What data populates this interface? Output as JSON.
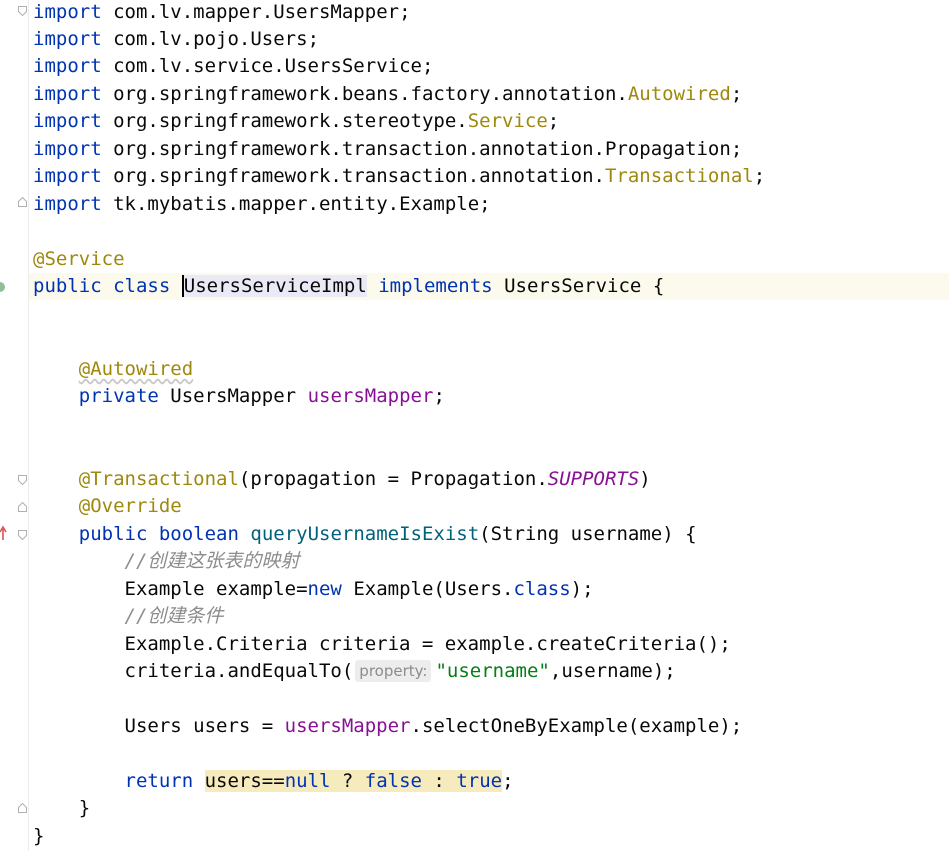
{
  "editor": {
    "imports": [
      {
        "kw": "import",
        "path": "com.lv.mapper.UsersMapper",
        "ann": "",
        "end": ";"
      },
      {
        "kw": "import",
        "path": "com.lv.pojo.Users",
        "ann": "",
        "end": ";"
      },
      {
        "kw": "import",
        "path": "com.lv.service.UsersService",
        "ann": "",
        "end": ";"
      },
      {
        "kw": "import",
        "path": "org.springframework.beans.factory.annotation.",
        "ann": "Autowired",
        "end": ";"
      },
      {
        "kw": "import",
        "path": "org.springframework.stereotype.",
        "ann": "Service",
        "end": ";"
      },
      {
        "kw": "import",
        "path": "org.springframework.transaction.annotation.Propagation",
        "ann": "",
        "end": ";"
      },
      {
        "kw": "import",
        "path": "org.springframework.transaction.annotation.",
        "ann": "Transactional",
        "end": ";"
      },
      {
        "kw": "import",
        "path": "tk.mybatis.mapper.entity.Example",
        "ann": "",
        "end": ";"
      }
    ],
    "class_annotation": "@Service",
    "class_decl": {
      "kw1": "public",
      "kw2": "class",
      "name": "UsersServiceImpl",
      "kw3": "implements",
      "iface": "UsersService",
      "brace": "{"
    },
    "field": {
      "annotation": "@Autowired",
      "kw": "private",
      "type": "UsersMapper",
      "name": "usersMapper",
      "end": ";"
    },
    "method": {
      "ann1": "@Transactional",
      "ann1_args_a": "(propagation = Propagation.",
      "ann1_const": "SUPPORTS",
      "ann1_args_b": ")",
      "ann2": "@Override",
      "kw1": "public",
      "kw2": "boolean",
      "name": "queryUsernameIsExist",
      "params": "(String username) {",
      "comment1": "//创建这张表的映射",
      "line1_a": "Example example=",
      "line1_new": "new",
      "line1_b": " Example(Users.",
      "line1_class": "class",
      "line1_c": ");",
      "comment2": "//创建条件",
      "line2": "Example.Criteria criteria = example.createCriteria();",
      "line3_a": "criteria.andEqualTo(",
      "line3_hint": "property:",
      "line3_str": "\"username\"",
      "line3_b": ",username);",
      "line4_a": "Users users = ",
      "line4_field": "usersMapper",
      "line4_b": ".selectOneByExample(example);",
      "ret_kw": "return",
      "ret_a": "users==",
      "ret_null": "null",
      "ret_b": " ? ",
      "ret_false": "false",
      "ret_c": " : ",
      "ret_true": "true",
      "ret_end": ";",
      "close": "}"
    },
    "class_close": "}"
  }
}
